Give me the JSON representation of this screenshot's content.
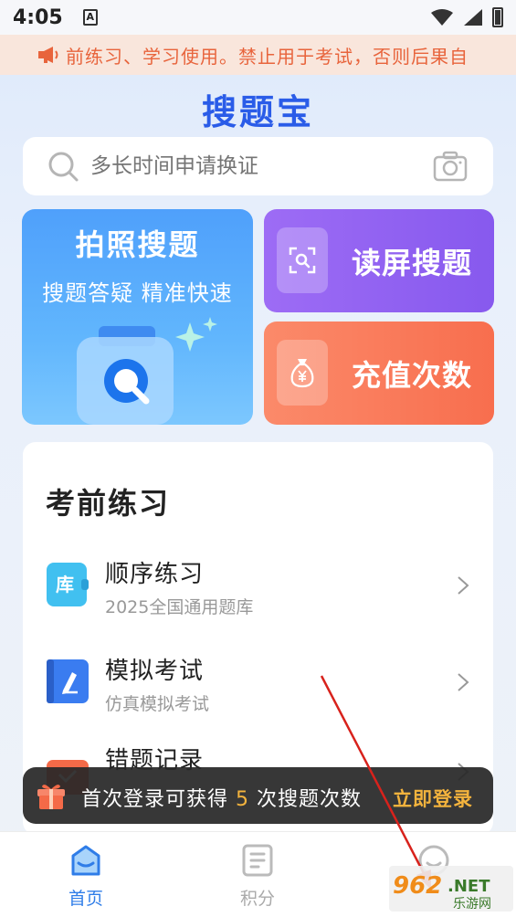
{
  "status_bar": {
    "time": "4:05",
    "app_indicator": "A"
  },
  "notice": {
    "text": "前练习、学习使用。禁止用于考试，否则后果自"
  },
  "app": {
    "title": "搜题宝"
  },
  "search": {
    "placeholder": "多长时间申请换证"
  },
  "cards": {
    "photo": {
      "title": "拍照搜题",
      "subtitle": "搜题答疑 精准快速"
    },
    "screen": {
      "label": "读屏搜题"
    },
    "recharge": {
      "label": "充值次数"
    }
  },
  "practice": {
    "title": "考前练习",
    "items": [
      {
        "name": "顺序练习",
        "subtitle": "2025全国通用题库",
        "icon_text": "库"
      },
      {
        "name": "模拟考试",
        "subtitle": "仿真模拟考试"
      },
      {
        "name": "错题记录",
        "subtitle": ""
      }
    ]
  },
  "toast": {
    "text_before": "首次登录可获得 ",
    "count": "5",
    "text_after": " 次搜题次数",
    "action": "立即登录"
  },
  "bottom_nav": {
    "items": [
      {
        "label": "首页",
        "active": true
      },
      {
        "label": "积分",
        "active": false
      },
      {
        "label": "",
        "active": false
      }
    ]
  },
  "watermark": {
    "brand": "962",
    "suffix": ".NET",
    "sub": "乐游网"
  },
  "colors": {
    "brand_blue": "#2a5ce8",
    "notice_text": "#e8643c",
    "highlight": "#f3b33d",
    "card_purple": "#8d5ff0",
    "card_orange": "#f97d5c"
  }
}
